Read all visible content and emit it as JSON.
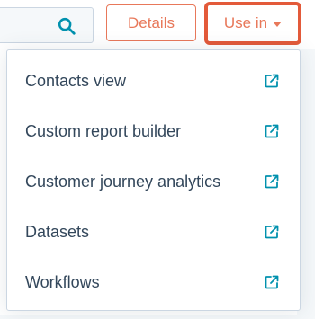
{
  "toolbar": {
    "details_label": "Details",
    "use_in_label": "Use in"
  },
  "menu": {
    "items": [
      {
        "label": "Contacts view",
        "icon": "external-link-icon"
      },
      {
        "label": "Custom report builder",
        "icon": "external-link-icon"
      },
      {
        "label": "Customer journey analytics",
        "icon": "external-link-icon"
      },
      {
        "label": "Datasets",
        "icon": "external-link-icon"
      },
      {
        "label": "Workflows",
        "icon": "external-link-icon"
      }
    ]
  },
  "colors": {
    "accent": "#e8785a",
    "highlight_outline": "#e35a3a",
    "icon_teal": "#0091ae",
    "text": "#33475b",
    "border": "#cbd6e2"
  }
}
